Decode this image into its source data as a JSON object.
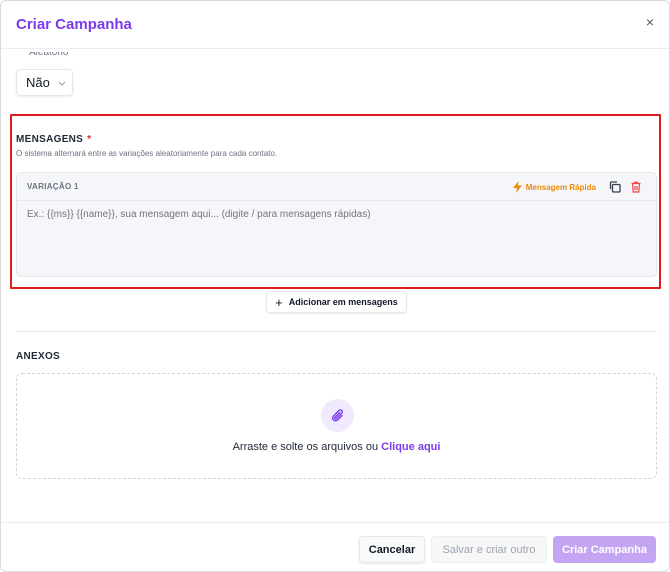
{
  "modal": {
    "title": "Criar Campanha",
    "close_symbol": "×"
  },
  "previous_field": {
    "label": "Aleatório",
    "selected": "Não"
  },
  "messages": {
    "label": "MENSAGENS",
    "required_mark": "*",
    "hint": "O sistema alternará entre as variações aleatoriamente para cada contato.",
    "variation_label": "VARIAÇÃO 1",
    "quick_message_label": "Mensagem Rápida",
    "placeholder": "Ex.: {{ms}} {{name}}, sua mensagem aqui... (digite / para mensagens rápidas)",
    "add_button_label": "Adicionar em mensagens"
  },
  "attachments": {
    "label": "ANEXOS",
    "drop_text": "Arraste e solte os arquivos ou",
    "drop_link": "Clique aqui"
  },
  "footer": {
    "cancel_label": "Cancelar",
    "save_other_label": "Salvar e criar outro",
    "create_label": "Criar Campanha"
  },
  "colors": {
    "accent": "#7c3aed",
    "highlight": "#e01b1b",
    "quick": "#ea8a0c",
    "delete": "#ef4444"
  },
  "icons": [
    "close-icon",
    "chevron-down-icon",
    "lightning-icon",
    "copy-icon",
    "trash-icon",
    "plus-icon",
    "paperclip-icon"
  ]
}
